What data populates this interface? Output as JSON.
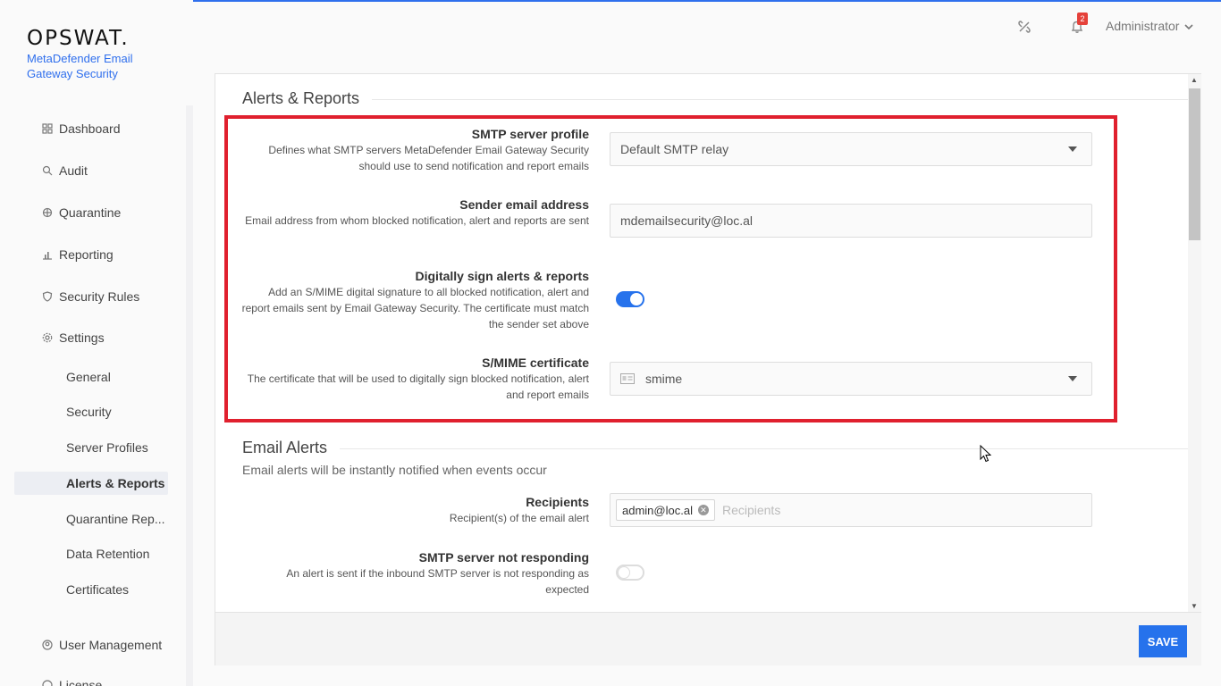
{
  "brand": {
    "logo": "OPSWAT.",
    "product": "MetaDefender Email Gateway Security"
  },
  "nav": {
    "dashboard": "Dashboard",
    "audit": "Audit",
    "quarantine": "Quarantine",
    "reporting": "Reporting",
    "security_rules": "Security Rules",
    "settings": "Settings",
    "sub": {
      "general": "General",
      "security": "Security",
      "server_profiles": "Server Profiles",
      "alerts_reports": "Alerts & Reports",
      "quarantine_reports": "Quarantine Rep...",
      "data_retention": "Data Retention",
      "certificates": "Certificates"
    },
    "user_management": "User Management",
    "license": "License"
  },
  "header": {
    "notification_count": "2",
    "user": "Administrator"
  },
  "alerts_reports": {
    "title": "Alerts & Reports",
    "smtp_profile": {
      "label": "SMTP server profile",
      "desc": "Defines what SMTP servers MetaDefender Email Gateway Security should use to send notification and report emails",
      "value": "Default SMTP relay"
    },
    "sender": {
      "label": "Sender email address",
      "desc": "Email address from whom blocked notification, alert and reports are sent",
      "value": "mdemailsecurity@loc.al"
    },
    "sign": {
      "label": "Digitally sign alerts & reports",
      "desc": "Add an S/MIME digital signature to all blocked notification, alert and report emails sent by Email Gateway Security. The certificate must match the sender set above",
      "enabled": true
    },
    "smime": {
      "label": "S/MIME certificate",
      "desc": "The certificate that will be used to digitally sign blocked notification, alert and report emails",
      "value": "smime"
    }
  },
  "email_alerts": {
    "title": "Email Alerts",
    "desc": "Email alerts will be instantly notified when events occur",
    "recipients": {
      "label": "Recipients",
      "desc": "Recipient(s) of the email alert",
      "chip": "admin@loc.al",
      "placeholder": "Recipients"
    },
    "smtp_not_responding": {
      "label": "SMTP server not responding",
      "desc": "An alert is sent if the inbound SMTP server is not responding as expected",
      "enabled": false
    }
  },
  "footer": {
    "save": "SAVE"
  },
  "colors": {
    "accent": "#2672ec",
    "highlight": "#e0202e",
    "brand_text": "#2f6fed"
  }
}
